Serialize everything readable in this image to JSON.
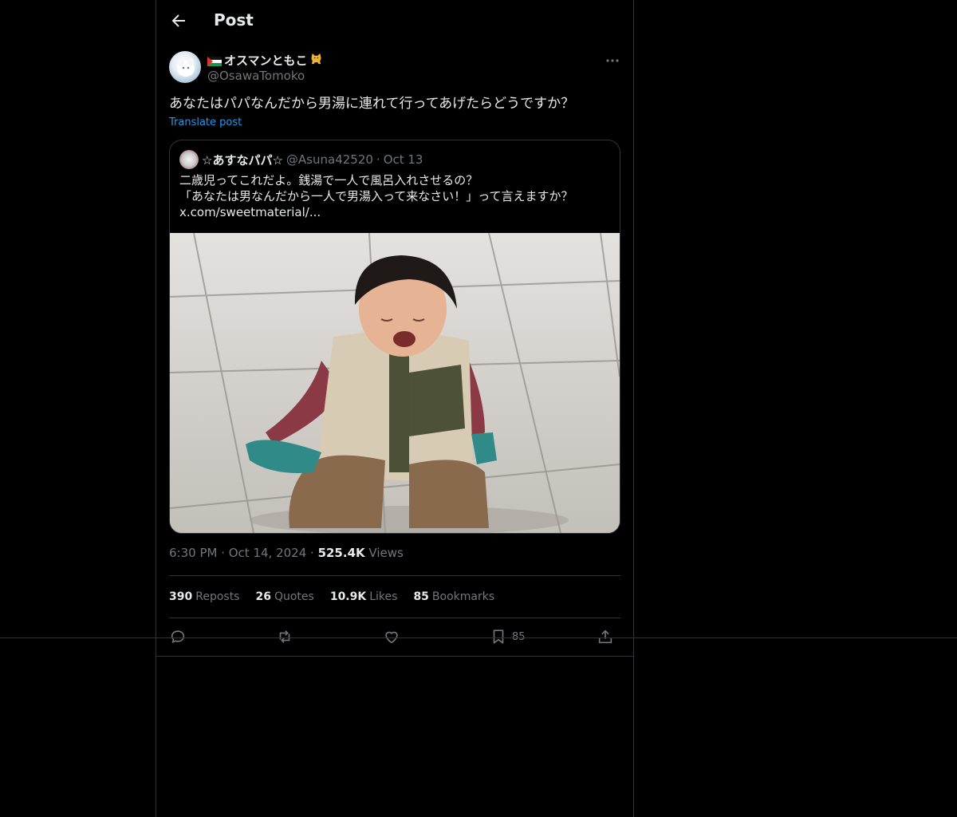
{
  "header": {
    "title": "Post"
  },
  "post": {
    "author_name": "オスマンともこ",
    "author_handle": "@OsawaTomoko",
    "text": "あなたはパパなんだから男湯に連れて行ってあげたらどうですか？",
    "translate_label": "Translate post",
    "time": "6:30 PM · Oct 14, 2024 · ",
    "views_count": "525.4K",
    "views_label": "Views"
  },
  "quote": {
    "author_name": "☆あすなパパ☆",
    "author_handle": "@Asuna42520",
    "separator": "·",
    "date": "Oct 13",
    "lines": [
      "二歳児ってこれだよ。銭湯で一人で風呂入れさせるの？",
      "「あなたは男なんだから一人で男湯入って来なさい！」って言えますか？",
      "x.com/sweetmaterial/..."
    ]
  },
  "stats": {
    "reposts_count": "390",
    "reposts_label": "Reposts",
    "quotes_count": "26",
    "quotes_label": "Quotes",
    "likes_count": "10.9K",
    "likes_label": "Likes",
    "bookmarks_count": "85",
    "bookmarks_label": "Bookmarks"
  },
  "actions": {
    "bookmark_count": "85"
  },
  "colors": {
    "background": "#000000",
    "border": "#2f3336",
    "text": "#e7e9ea",
    "muted": "#71767b",
    "accent": "#1d9bf0"
  }
}
